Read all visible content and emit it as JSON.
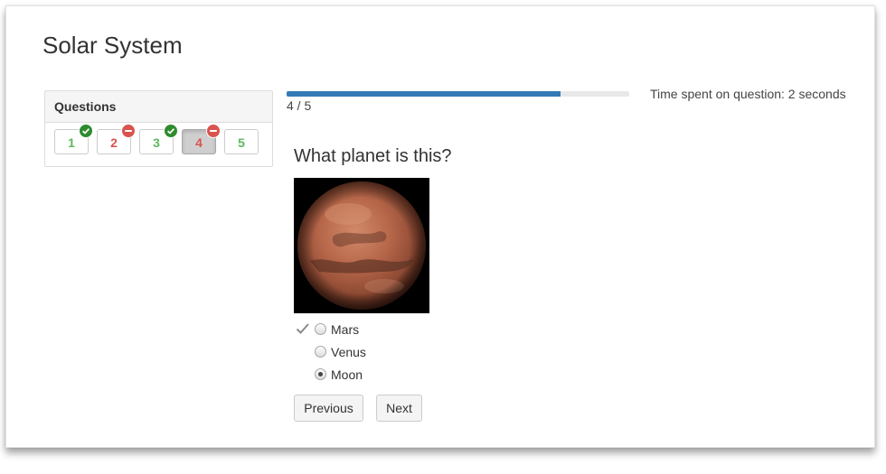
{
  "page": {
    "title": "Solar System"
  },
  "questions_panel": {
    "header": "Questions",
    "items": [
      {
        "label": "1",
        "status": "correct"
      },
      {
        "label": "2",
        "status": "incorrect"
      },
      {
        "label": "3",
        "status": "correct"
      },
      {
        "label": "4",
        "status": "incorrect",
        "active": true
      },
      {
        "label": "5",
        "status": "unanswered"
      }
    ]
  },
  "progress": {
    "label": "4 / 5",
    "fraction": 0.8
  },
  "timer": {
    "text": "Time spent on question: 2 seconds"
  },
  "question": {
    "text": "What planet is this?",
    "answers": [
      {
        "label": "Mars",
        "selected": false,
        "marked_correct": true
      },
      {
        "label": "Venus",
        "selected": false,
        "marked_correct": false
      },
      {
        "label": "Moon",
        "selected": true,
        "marked_correct": false
      }
    ]
  },
  "nav": {
    "previous_label": "Previous",
    "next_label": "Next"
  },
  "colors": {
    "progress_fill": "#337ab7",
    "correct_badge": "#2e8b2e",
    "incorrect_badge": "#d9534f",
    "correct_text": "#5cb85c",
    "incorrect_text": "#d9534f"
  }
}
